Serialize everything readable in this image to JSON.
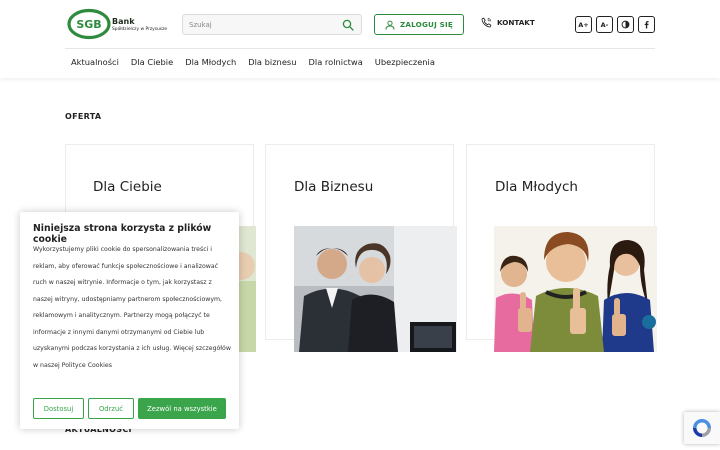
{
  "brand": {
    "logo_text": "SGB",
    "name": "Bank",
    "subtitle": "Spółdzielczy w Przysusze",
    "accent_color": "#2e8b3e"
  },
  "search": {
    "placeholder": "Szukaj",
    "value": ""
  },
  "header": {
    "login_label": "ZALOGUJ SIĘ",
    "contact_label": "KONTAKT",
    "font_increase_label": "A+",
    "font_decrease_label": "A-",
    "contrast_icon": "contrast-icon",
    "facebook_icon": "facebook-icon"
  },
  "nav": {
    "items": [
      {
        "label": "Aktualności"
      },
      {
        "label": "Dla Ciebie"
      },
      {
        "label": "Dla Młodych"
      },
      {
        "label": "Dla biznesu"
      },
      {
        "label": "Dla rolnictwa"
      },
      {
        "label": "Ubezpieczenia"
      }
    ]
  },
  "offer": {
    "section_title": "OFERTA",
    "cards": [
      {
        "title": "Dla Ciebie"
      },
      {
        "title": "Dla Biznesu"
      },
      {
        "title": "Dla Młodych"
      }
    ]
  },
  "news": {
    "section_title": "AKTUALNOŚCI"
  },
  "cookie_banner": {
    "title": "Niniejsza strona korzysta z plików cookie",
    "text": "Wykorzystujemy pliki cookie do spersonalizowania treści i reklam, aby oferować funkcje społecznościowe i analizować ruch w naszej witrynie. Informacje o tym, jak korzystasz z naszej witryny, udostępniamy partnerom społecznościowym, reklamowym i analitycznym. Partnerzy mogą połączyć te informacje z innymi danymi otrzymanymi od Ciebie lub uzyskanymi podczas korzystania z ich usług. Więcej szczegółów w naszej Polityce Cookies",
    "customize_label": "Dostosuj",
    "reject_label": "Odrzuć",
    "accept_label": "Zezwól na wszystkie"
  }
}
